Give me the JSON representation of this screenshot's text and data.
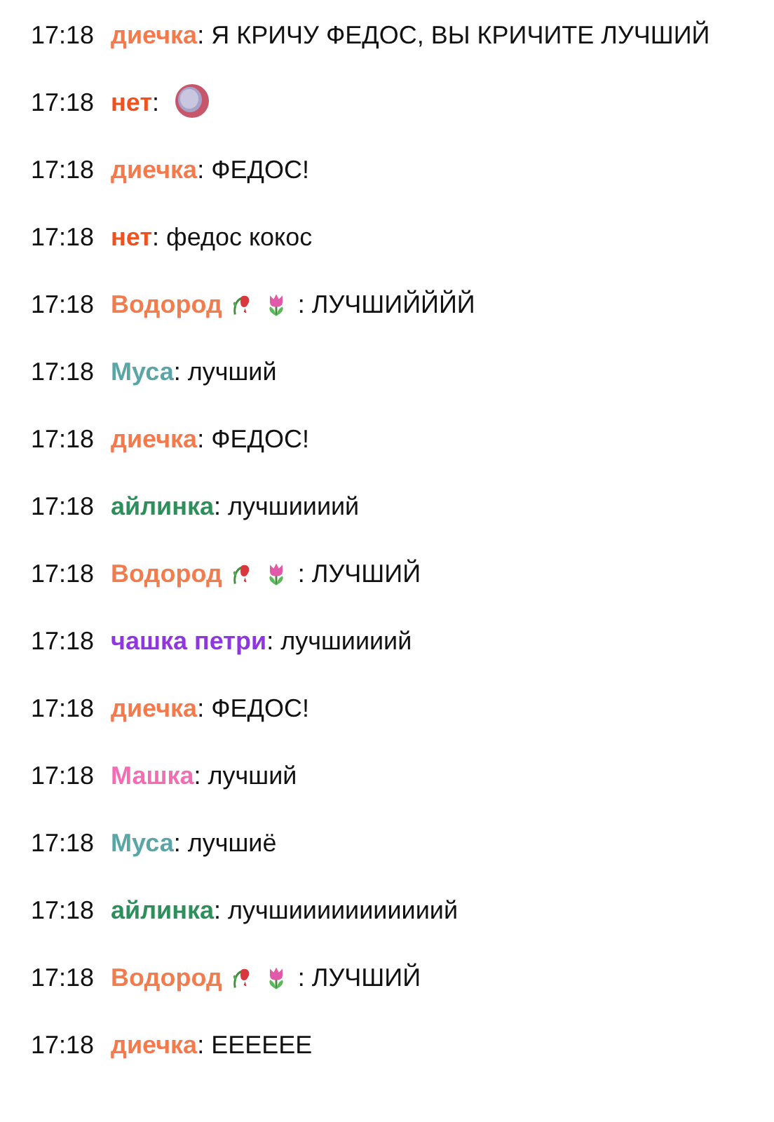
{
  "messages": [
    {
      "kind": "text",
      "time": "17:18",
      "author": "диечка",
      "color": "#f47a4c",
      "text": ": Я КРИЧУ ФЕДОС, ВЫ КРИЧИТЕ ЛУЧШИЙ"
    },
    {
      "kind": "sticker",
      "time": "17:18",
      "author": "нет",
      "color": "#f0521f",
      "text": ":"
    },
    {
      "kind": "text",
      "time": "17:18",
      "author": "диечка",
      "color": "#f47a4c",
      "text": ": ФЕДОС!"
    },
    {
      "kind": "text",
      "time": "17:18",
      "author": "нет",
      "color": "#f0521f",
      "text": ": федос кокос"
    },
    {
      "kind": "flowers",
      "time": "17:18",
      "author": "Водород",
      "color": "#f07d50",
      "text": ": ЛУЧШИЙЙЙЙ"
    },
    {
      "kind": "text",
      "time": "17:18",
      "author": "Муса",
      "color": "#5aa6a6",
      "text": ": лучший"
    },
    {
      "kind": "text",
      "time": "17:18",
      "author": "диечка",
      "color": "#f47a4c",
      "text": ": ФЕДОС!"
    },
    {
      "kind": "text",
      "time": "17:18",
      "author": "айлинка",
      "color": "#2f8f5a",
      "text": ": лучшиииий"
    },
    {
      "kind": "flowers",
      "time": "17:18",
      "author": "Водород",
      "color": "#f07d50",
      "text": ": ЛУЧШИЙ"
    },
    {
      "kind": "text",
      "time": "17:18",
      "author": "чашка петри",
      "color": "#9036e0",
      "text": ": лучшиииий"
    },
    {
      "kind": "text",
      "time": "17:18",
      "author": "диечка",
      "color": "#f47a4c",
      "text": ": ФЕДОС!"
    },
    {
      "kind": "text",
      "time": "17:18",
      "author": "Машка",
      "color": "#f46cb4",
      "text": ": лучший"
    },
    {
      "kind": "text",
      "time": "17:18",
      "author": "Муса",
      "color": "#5aa6a6",
      "text": ": лучшиё"
    },
    {
      "kind": "text",
      "time": "17:18",
      "author": "айлинка",
      "color": "#2f8f5a",
      "text": ": лучшииииииииииий"
    },
    {
      "kind": "flowers",
      "time": "17:18",
      "author": "Водород",
      "color": "#f07d50",
      "text": ": ЛУЧШИЙ"
    },
    {
      "kind": "text",
      "time": "17:18",
      "author": "диечка",
      "color": "#f47a4c",
      "text": ": ЕЕЕЕЕЕ"
    }
  ]
}
